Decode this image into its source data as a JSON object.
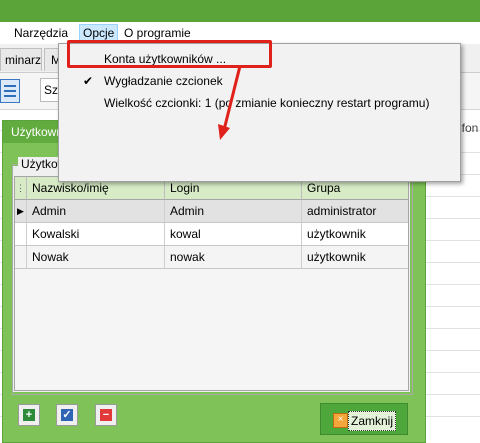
{
  "menubar": {
    "items": [
      "Narzędzia",
      "Opcje",
      "O programie"
    ]
  },
  "tabs": [
    "minarz",
    "Map"
  ],
  "toolbar": {
    "search_placeholder": "Szuka"
  },
  "background": {
    "column_label": "efon"
  },
  "dropdown": {
    "items": [
      {
        "label": "Konta użytkowników ...",
        "checked": false
      },
      {
        "label": "Wygładzanie czcionek",
        "checked": true
      },
      {
        "label": "Wielkość czcionki: 1 (po zmianie konieczny restart programu)",
        "checked": false
      }
    ],
    "check_mark": "✔"
  },
  "dialog": {
    "title": "Użytkownicy programu",
    "group_label": "Użytkownicy:",
    "columns": [
      "Nazwisko/imię",
      "Login",
      "Grupa"
    ],
    "rows": [
      {
        "name": "Admin",
        "login": "Admin",
        "group": "administrator",
        "selected": true
      },
      {
        "name": "Kowalski",
        "login": "kowal",
        "group": "użytkownik",
        "selected": false
      },
      {
        "name": "Nowak",
        "login": "nowak",
        "group": "użytkownik",
        "selected": false
      }
    ],
    "close_label": "Zamknij",
    "add_symbol": "+",
    "edit_symbol": "✓",
    "delete_symbol": "−",
    "close_symbol": "×"
  },
  "colors": {
    "accent_green": "#5aa43a",
    "highlight_red": "#e0201b"
  }
}
